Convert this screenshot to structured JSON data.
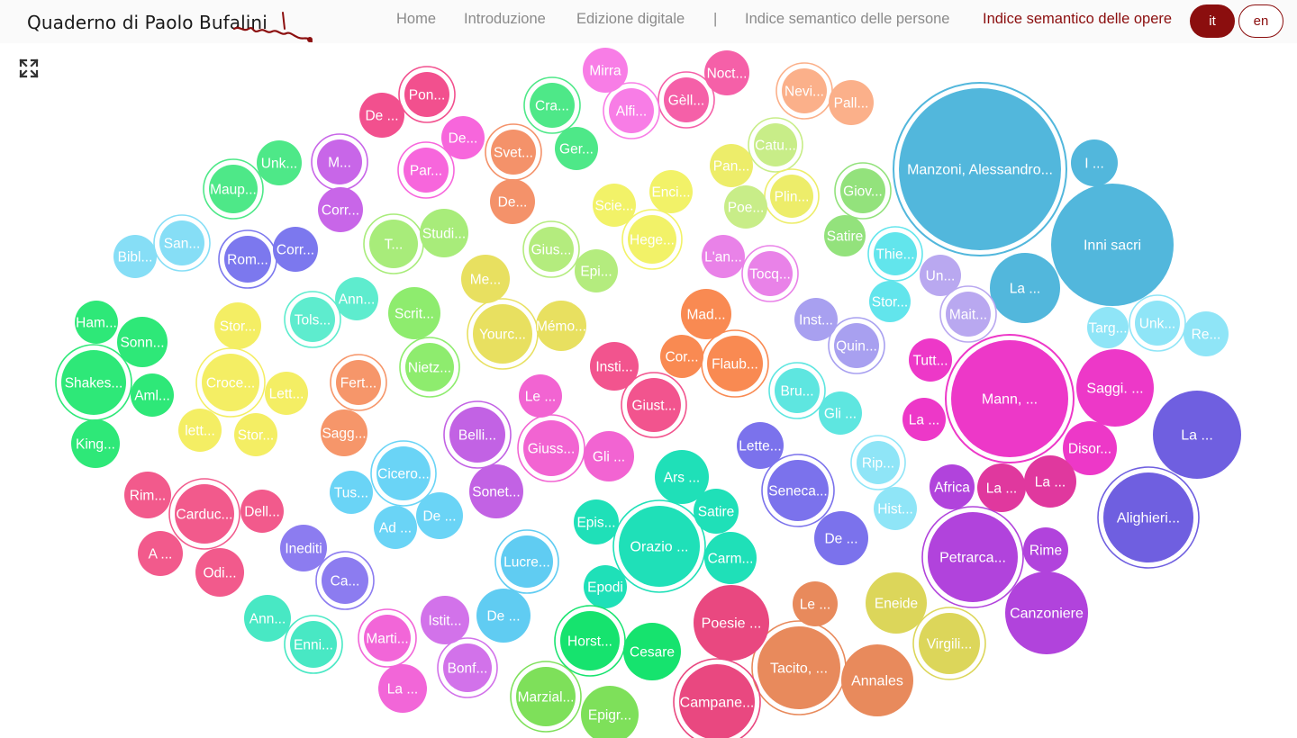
{
  "header": {
    "logo_text": "Quaderno di Paolo Bufalini",
    "nav": [
      {
        "label": "Home"
      },
      {
        "label": "Introduzione"
      },
      {
        "label": "Edizione digitale"
      },
      {
        "label": "Indice semantico delle persone"
      },
      {
        "label": "Indice semantico delle opere"
      }
    ],
    "separator": "|",
    "lang": {
      "it": "it",
      "en": "en"
    }
  },
  "bubbles": [
    {
      "label": "Manzoni, Alessandro...",
      "color": "#52b7dc",
      "ring": true
    },
    {
      "label": "Inni sacri",
      "color": "#52b7dc",
      "ring": false
    },
    {
      "label": "I ...",
      "color": "#52b7dc",
      "ring": false
    },
    {
      "label": "La ...",
      "color": "#52b7dc",
      "ring": false
    },
    {
      "label": "Mann, ...",
      "color": "#ed38c8",
      "ring": true
    },
    {
      "label": "Saggi. ...",
      "color": "#ed38c8",
      "ring": false
    },
    {
      "label": "Disor...",
      "color": "#ed38c8",
      "ring": false
    },
    {
      "label": "Tutt...",
      "color": "#ed38c8",
      "ring": false
    },
    {
      "label": "La ...",
      "color": "#ed38c8",
      "ring": false
    },
    {
      "label": "La ...",
      "color": "#6f5fe0",
      "ring": false
    },
    {
      "label": "Alighieri...",
      "color": "#6f5fe0",
      "ring": true
    },
    {
      "label": "Petrarca...",
      "color": "#b143dc",
      "ring": true
    },
    {
      "label": "Rime",
      "color": "#b143dc",
      "ring": false
    },
    {
      "label": "Canzoniere",
      "color": "#b143dc",
      "ring": false
    },
    {
      "label": "Africa",
      "color": "#b143dc",
      "ring": false
    },
    {
      "label": "La ...",
      "color": "#e0389e",
      "ring": false
    },
    {
      "label": "La ...",
      "color": "#e0389e",
      "ring": false
    },
    {
      "label": "Eneide",
      "color": "#dcd65a",
      "ring": false
    },
    {
      "label": "Virgili...",
      "color": "#dcd65a",
      "ring": true
    },
    {
      "label": "Tacito, ...",
      "color": "#e88a5c",
      "ring": true
    },
    {
      "label": "Annales",
      "color": "#e88a5c",
      "ring": false
    },
    {
      "label": "Le ...",
      "color": "#e88a5c",
      "ring": false
    },
    {
      "label": "Campane...",
      "color": "#e94880",
      "ring": true
    },
    {
      "label": "Poesie ...",
      "color": "#e94880",
      "ring": false
    },
    {
      "label": "Orazio ...",
      "color": "#1fe0b8",
      "ring": true
    },
    {
      "label": "Ars ...",
      "color": "#1fe0b8",
      "ring": false
    },
    {
      "label": "Satire",
      "color": "#1fe0b8",
      "ring": false
    },
    {
      "label": "Carm...",
      "color": "#1fe0b8",
      "ring": false
    },
    {
      "label": "Epis...",
      "color": "#1fe0b8",
      "ring": false
    },
    {
      "label": "Epodi",
      "color": "#1fe0b8",
      "ring": false
    },
    {
      "label": "Horst...",
      "color": "#16e36e",
      "ring": true
    },
    {
      "label": "Cesare",
      "color": "#16e36e",
      "ring": false
    },
    {
      "label": "Marzial...",
      "color": "#7ee05a",
      "ring": true
    },
    {
      "label": "Epigr...",
      "color": "#7ee05a",
      "ring": false
    },
    {
      "label": "Seneca...",
      "color": "#7b72ec",
      "ring": true
    },
    {
      "label": "De ...",
      "color": "#7b72ec",
      "ring": false
    },
    {
      "label": "Lette...",
      "color": "#7b72ec",
      "ring": false
    },
    {
      "label": "Rip...",
      "color": "#8fe5f7",
      "ring": true
    },
    {
      "label": "Hist...",
      "color": "#8fe5f7",
      "ring": false
    },
    {
      "label": "Bru...",
      "color": "#5ee6e0",
      "ring": true
    },
    {
      "label": "Gli ...",
      "color": "#5ee6e0",
      "ring": false
    },
    {
      "label": "Quin...",
      "color": "#a8a0f0",
      "ring": true
    },
    {
      "label": "Inst...",
      "color": "#a8a0f0",
      "ring": false
    },
    {
      "label": "Mait...",
      "color": "#b9a8f0",
      "ring": true
    },
    {
      "label": "Un...",
      "color": "#b9a8f0",
      "ring": false
    },
    {
      "label": "Thie...",
      "color": "#62e5ec",
      "ring": true
    },
    {
      "label": "Stor...",
      "color": "#62e5ec",
      "ring": false
    },
    {
      "label": "Targ...",
      "color": "#8fe5f7",
      "ring": false
    },
    {
      "label": "Unk...",
      "color": "#8fe5f7",
      "ring": true
    },
    {
      "label": "Re...",
      "color": "#8fe5f7",
      "ring": false
    },
    {
      "label": "Giov...",
      "color": "#93e27c",
      "ring": true
    },
    {
      "label": "Satire",
      "color": "#93e27c",
      "ring": false
    },
    {
      "label": "Catu...",
      "color": "#c8ed88",
      "ring": true
    },
    {
      "label": "Plin...",
      "color": "#eded6a",
      "ring": true
    },
    {
      "label": "Pan...",
      "color": "#eded6a",
      "ring": false
    },
    {
      "label": "Poe...",
      "color": "#c8ed88",
      "ring": false
    },
    {
      "label": "Nevi...",
      "color": "#fbb08a",
      "ring": true
    },
    {
      "label": "Pall...",
      "color": "#fbb08a",
      "ring": false
    },
    {
      "label": "Noct...",
      "color": "#f560a8",
      "ring": false
    },
    {
      "label": "Gèll...",
      "color": "#f560a8",
      "ring": true
    },
    {
      "label": "Mirra",
      "color": "#f87de6",
      "ring": false
    },
    {
      "label": "Alfi...",
      "color": "#f87de6",
      "ring": true
    },
    {
      "label": "Cra...",
      "color": "#4ee888",
      "ring": true
    },
    {
      "label": "Ger...",
      "color": "#4ee888",
      "ring": false
    },
    {
      "label": "Svet...",
      "color": "#f4926a",
      "ring": true
    },
    {
      "label": "De...",
      "color": "#f4926a",
      "ring": false
    },
    {
      "label": "Enci...",
      "color": "#f2f268",
      "ring": false
    },
    {
      "label": "Hege...",
      "color": "#f2f268",
      "ring": true
    },
    {
      "label": "Scie...",
      "color": "#f2f268",
      "ring": false
    },
    {
      "label": "Gius...",
      "color": "#b4ec7e",
      "ring": true
    },
    {
      "label": "Epi...",
      "color": "#b4ec7e",
      "ring": false
    },
    {
      "label": "L'an...",
      "color": "#e982e8",
      "ring": false
    },
    {
      "label": "Tocq...",
      "color": "#e982e8",
      "ring": true
    },
    {
      "label": "Mad...",
      "color": "#f98a52",
      "ring": false
    },
    {
      "label": "Cor...",
      "color": "#f98a52",
      "ring": false
    },
    {
      "label": "Flaub...",
      "color": "#f98a52",
      "ring": true
    },
    {
      "label": "Insti...",
      "color": "#f2548e",
      "ring": false
    },
    {
      "label": "Giust...",
      "color": "#f2548e",
      "ring": true
    },
    {
      "label": "Me...",
      "color": "#e8e060",
      "ring": false
    },
    {
      "label": "Yourc...",
      "color": "#e8e060",
      "ring": true
    },
    {
      "label": "Mémo...",
      "color": "#e8e060",
      "ring": false
    },
    {
      "label": "Le ...",
      "color": "#f264d2",
      "ring": false
    },
    {
      "label": "Giuss...",
      "color": "#f264d2",
      "ring": true
    },
    {
      "label": "Gli ...",
      "color": "#f264d2",
      "ring": false
    },
    {
      "label": "Belli...",
      "color": "#c262e4",
      "ring": true
    },
    {
      "label": "Sonet...",
      "color": "#c262e4",
      "ring": false
    },
    {
      "label": "Pon...",
      "color": "#f2508e",
      "ring": true
    },
    {
      "label": "De ...",
      "color": "#f2508e",
      "ring": false
    },
    {
      "label": "De...",
      "color": "#f766dc",
      "ring": false
    },
    {
      "label": "Par...",
      "color": "#f766dc",
      "ring": true
    },
    {
      "label": "M...",
      "color": "#c866e8",
      "ring": true
    },
    {
      "label": "Corr...",
      "color": "#c866e8",
      "ring": false
    },
    {
      "label": "Unk...",
      "color": "#4ee888",
      "ring": false
    },
    {
      "label": "Maup...",
      "color": "#4ee888",
      "ring": true
    },
    {
      "label": "T...",
      "color": "#a8ec7a",
      "ring": true
    },
    {
      "label": "Studi...",
      "color": "#a8ec7a",
      "ring": false
    },
    {
      "label": "San...",
      "color": "#86def6",
      "ring": true
    },
    {
      "label": "Bibl...",
      "color": "#86def6",
      "ring": false
    },
    {
      "label": "Rom...",
      "color": "#7c78ee",
      "ring": true
    },
    {
      "label": "Corr...",
      "color": "#7c78ee",
      "ring": false
    },
    {
      "label": "Ann...",
      "color": "#5eecce",
      "ring": false
    },
    {
      "label": "Tols...",
      "color": "#5eecce",
      "ring": true
    },
    {
      "label": "Scrit...",
      "color": "#8eec6e",
      "ring": false
    },
    {
      "label": "Nietz...",
      "color": "#8eec6e",
      "ring": true
    },
    {
      "label": "Ham...",
      "color": "#2ee878",
      "ring": false
    },
    {
      "label": "Sonn...",
      "color": "#2ee878",
      "ring": false
    },
    {
      "label": "Shakes...",
      "color": "#2ee878",
      "ring": true
    },
    {
      "label": "Aml...",
      "color": "#2ee878",
      "ring": false
    },
    {
      "label": "King...",
      "color": "#2ee878",
      "ring": false
    },
    {
      "label": "Stor...",
      "color": "#f4ee64",
      "ring": false
    },
    {
      "label": "Croce...",
      "color": "#f4ee64",
      "ring": true
    },
    {
      "label": "Lett...",
      "color": "#f4ee64",
      "ring": false
    },
    {
      "label": "lett...",
      "color": "#f4ee64",
      "ring": false
    },
    {
      "label": "Stor...",
      "color": "#f4ee64",
      "ring": false
    },
    {
      "label": "Fert...",
      "color": "#f6966a",
      "ring": true
    },
    {
      "label": "Sagg...",
      "color": "#f6966a",
      "ring": false
    },
    {
      "label": "Cicero...",
      "color": "#6ad4f6",
      "ring": true
    },
    {
      "label": "Tus...",
      "color": "#6ad4f6",
      "ring": false
    },
    {
      "label": "De ...",
      "color": "#6ad4f6",
      "ring": false
    },
    {
      "label": "Ad ...",
      "color": "#6ad4f6",
      "ring": false
    },
    {
      "label": "Rim...",
      "color": "#f25a8c",
      "ring": false
    },
    {
      "label": "Carduc...",
      "color": "#f25a8c",
      "ring": true
    },
    {
      "label": "Dell...",
      "color": "#f25a8c",
      "ring": false
    },
    {
      "label": "A ...",
      "color": "#f25a8c",
      "ring": false
    },
    {
      "label": "Odi...",
      "color": "#f25a8c",
      "ring": false
    },
    {
      "label": "Inediti",
      "color": "#8c7cf0",
      "ring": false
    },
    {
      "label": "Ca...",
      "color": "#8c7cf0",
      "ring": true
    },
    {
      "label": "Lucre...",
      "color": "#60ccf2",
      "ring": true
    },
    {
      "label": "De ...",
      "color": "#60ccf2",
      "ring": false
    },
    {
      "label": "Ann...",
      "color": "#48e8c4",
      "ring": false
    },
    {
      "label": "Enni...",
      "color": "#48e8c4",
      "ring": true
    },
    {
      "label": "Marti...",
      "color": "#f266d8",
      "ring": true
    },
    {
      "label": "La ...",
      "color": "#f266d8",
      "ring": false
    },
    {
      "label": "Istit...",
      "color": "#d272ea",
      "ring": false
    },
    {
      "label": "Bonf...",
      "color": "#d272ea",
      "ring": true
    }
  ]
}
